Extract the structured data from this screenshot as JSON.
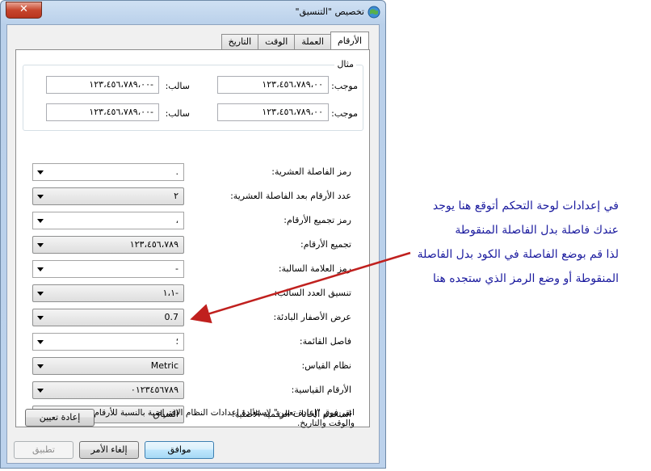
{
  "window": {
    "title": "تخصيص \"التنسيق\"",
    "close_label": "✕"
  },
  "tabs": [
    {
      "label": "الأرقام",
      "active": true
    },
    {
      "label": "العملة",
      "active": false
    },
    {
      "label": "الوقت",
      "active": false
    },
    {
      "label": "التاريخ",
      "active": false
    }
  ],
  "sample": {
    "legend": "مثال",
    "positive_label": "موجب:",
    "negative_label": "سالب:",
    "row1_positive": "١٢٣،٤٥٦،٧٨٩،٠٠",
    "row1_negative": "-١٢٣،٤٥٦،٧٨٩،٠٠",
    "row2_positive": "١٢٣،٤٥٦،٧٨٩،٠٠",
    "row2_negative": "-١٢٣،٤٥٦،٧٨٩،٠٠"
  },
  "settings": [
    {
      "label": "رمز الفاصلة العشرية:",
      "value": ".",
      "readonly": false
    },
    {
      "label": "عدد الأرقام بعد الفاصلة العشرية:",
      "value": "٢",
      "readonly": true
    },
    {
      "label": "رمز تجميع الأرقام:",
      "value": "،",
      "readonly": false
    },
    {
      "label": "تجميع الأرقام:",
      "value": "١٢٣،٤٥٦،٧٨٩",
      "readonly": true
    },
    {
      "label": "رمز العلامة السالبة:",
      "value": "-",
      "readonly": false
    },
    {
      "label": "تنسيق العدد السالب:",
      "value": "-١،١",
      "readonly": true
    },
    {
      "label": "عرض الأصفار البادئة:",
      "value": "0.7",
      "readonly": true
    },
    {
      "label": "فاصل القائمة:",
      "value": "؛",
      "readonly": false
    },
    {
      "label": "نظام القياس:",
      "value": "Metric",
      "readonly": true
    },
    {
      "label": "الأرقام القياسية:",
      "value": "٠١٢٣٤٥٦٧٨٩",
      "readonly": true
    },
    {
      "label": "استخدم الخانات الرقمية الأصلية:",
      "value": "السياق",
      "readonly": true
    }
  ],
  "reset": {
    "note": "انقر فوق \"إعادة تعيين\" لاستعادة إعدادات النظام الافتراضية بالنسبة للأرقام والعملة والوقت والتاريخ.",
    "button": "إعادة تعيين"
  },
  "buttons": {
    "ok": "موافق",
    "cancel": "إلغاء الأمر",
    "apply": "تطبيق"
  },
  "annotation": {
    "lines": [
      "في إعدادات لوحة التحكم أتوقع هنا يوجد",
      "عندك فاصلة بدل الفاصلة المنقوطة",
      "لذا قم بوضع الفاصلة في الكود بدل الفاصلة",
      "المنقوطة أو وضع الرمز الذي ستجده هنا"
    ],
    "color": "#1a1a9e",
    "arrow_color": "#c0201e"
  }
}
